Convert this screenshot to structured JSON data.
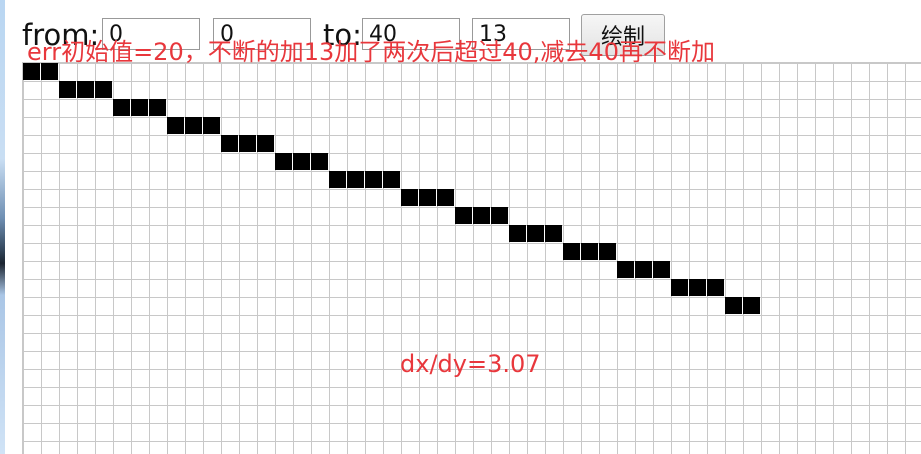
{
  "controls": {
    "from_label": "from:",
    "from_x": "0",
    "from_y": "0",
    "to_label": "to:",
    "to_x": "40",
    "to_y": "13",
    "draw_button": "绘制"
  },
  "annotations": {
    "err_note": "err初始值=20，不断的加13加了两次后超过40,减去40再不断加",
    "slope_note": "dx/dy=3.07"
  },
  "raster": {
    "cells": [
      [
        0,
        0
      ],
      [
        1,
        0
      ],
      [
        2,
        1
      ],
      [
        3,
        1
      ],
      [
        4,
        1
      ],
      [
        5,
        2
      ],
      [
        6,
        2
      ],
      [
        7,
        2
      ],
      [
        8,
        3
      ],
      [
        9,
        3
      ],
      [
        10,
        3
      ],
      [
        11,
        4
      ],
      [
        12,
        4
      ],
      [
        13,
        4
      ],
      [
        14,
        5
      ],
      [
        15,
        5
      ],
      [
        16,
        5
      ],
      [
        17,
        6
      ],
      [
        18,
        6
      ],
      [
        19,
        6
      ],
      [
        20,
        6
      ],
      [
        21,
        7
      ],
      [
        22,
        7
      ],
      [
        23,
        7
      ],
      [
        24,
        8
      ],
      [
        25,
        8
      ],
      [
        26,
        8
      ],
      [
        27,
        9
      ],
      [
        28,
        9
      ],
      [
        29,
        9
      ],
      [
        30,
        10
      ],
      [
        31,
        10
      ],
      [
        32,
        10
      ],
      [
        33,
        11
      ],
      [
        34,
        11
      ],
      [
        35,
        11
      ],
      [
        36,
        12
      ],
      [
        37,
        12
      ],
      [
        38,
        12
      ],
      [
        39,
        13
      ],
      [
        40,
        13
      ]
    ],
    "fill_color": "#000000",
    "grid_color": "#c8c8c8"
  },
  "colors": {
    "annotation": "#e8373c"
  }
}
